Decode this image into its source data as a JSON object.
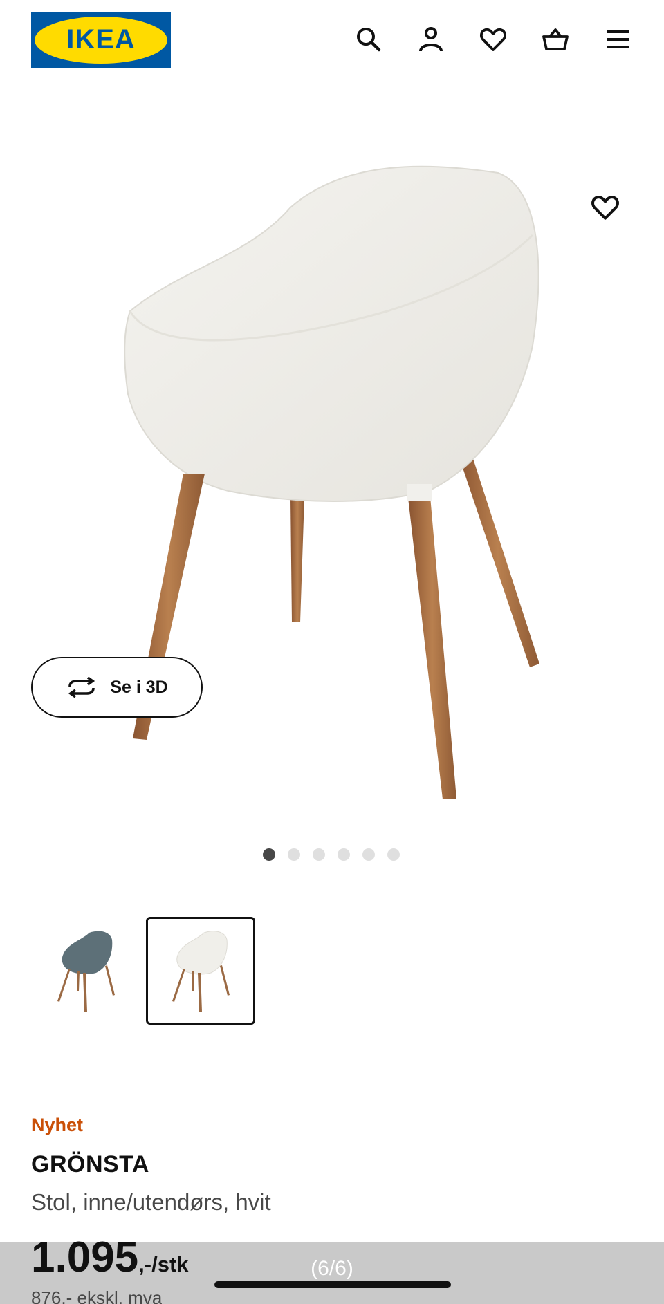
{
  "header": {
    "logo_text": "IKEA",
    "icons": [
      "search-icon",
      "account-icon",
      "wishlist-icon",
      "basket-icon",
      "menu-icon"
    ],
    "colors": {
      "logo_blue": "#0058a3",
      "logo_yellow": "#ffdb00"
    }
  },
  "gallery": {
    "favorite_icon": "heart-icon",
    "view_3d_label": "Se i 3D",
    "dots_total": 6,
    "dots_active": 1,
    "counter": "(6/6)"
  },
  "variants": [
    {
      "color": "blue-grey",
      "selected": false
    },
    {
      "color": "white",
      "selected": true
    }
  ],
  "product": {
    "badge": "Nyhet",
    "name": "GRÖNSTA",
    "description": "Stol, inne/utendørs, hvit",
    "price": "1.095",
    "price_suffix": ",-/stk",
    "price_ex_vat": "876,- ekskl. mva",
    "badge_color": "#ca5008"
  }
}
